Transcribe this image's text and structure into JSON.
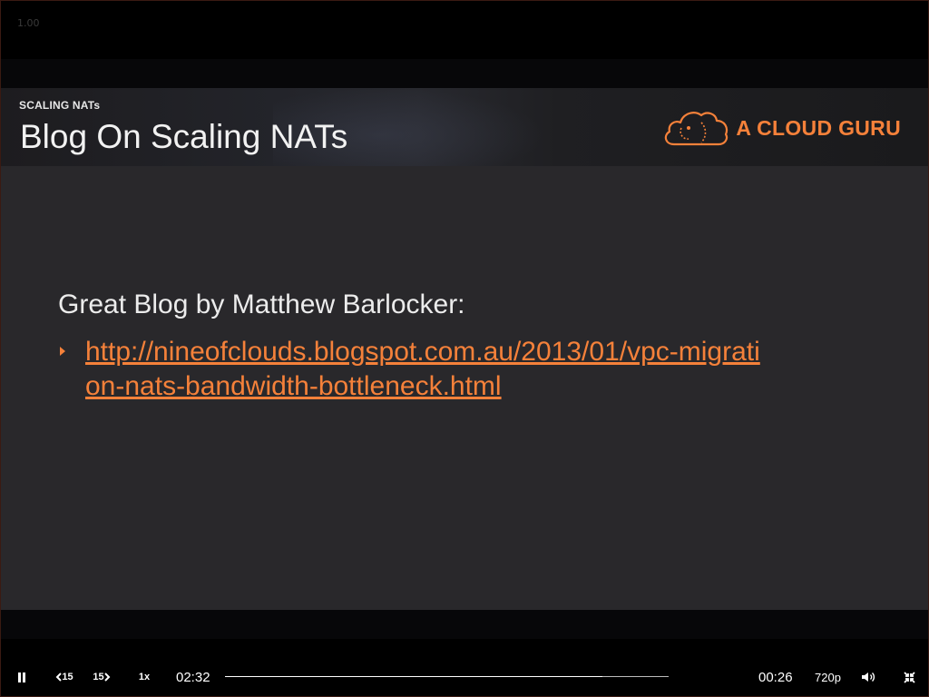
{
  "player": {
    "version": "1.00"
  },
  "slide": {
    "section_label": "SCALING NATs",
    "title": "Blog On Scaling NATs",
    "brand_name": "A CLOUD GURU",
    "lead_text": "Great Blog by Matthew Barlocker:",
    "link_text": "http://nineofclouds.blogspot.com.au/2013/01/vpc-migration-nats-bandwidth-bottleneck.html",
    "link_href": "http://nineofclouds.blogspot.com.au/2013/01/vpc-migration-nats-bandwidth-bottleneck.html"
  },
  "controls": {
    "pause_icon": "pause-icon",
    "rewind_label": "15",
    "forward_label": "15",
    "speed_label": "1x",
    "elapsed_time": "02:32",
    "remaining_time": "00:26",
    "quality_label": "720p",
    "volume_icon": "volume-icon",
    "exit_fullscreen_icon": "exit-fullscreen-icon",
    "progress_fraction": 0.85
  },
  "colors": {
    "accent": "#f5813a",
    "slide_background": "#29282b",
    "player_background": "#000000"
  }
}
